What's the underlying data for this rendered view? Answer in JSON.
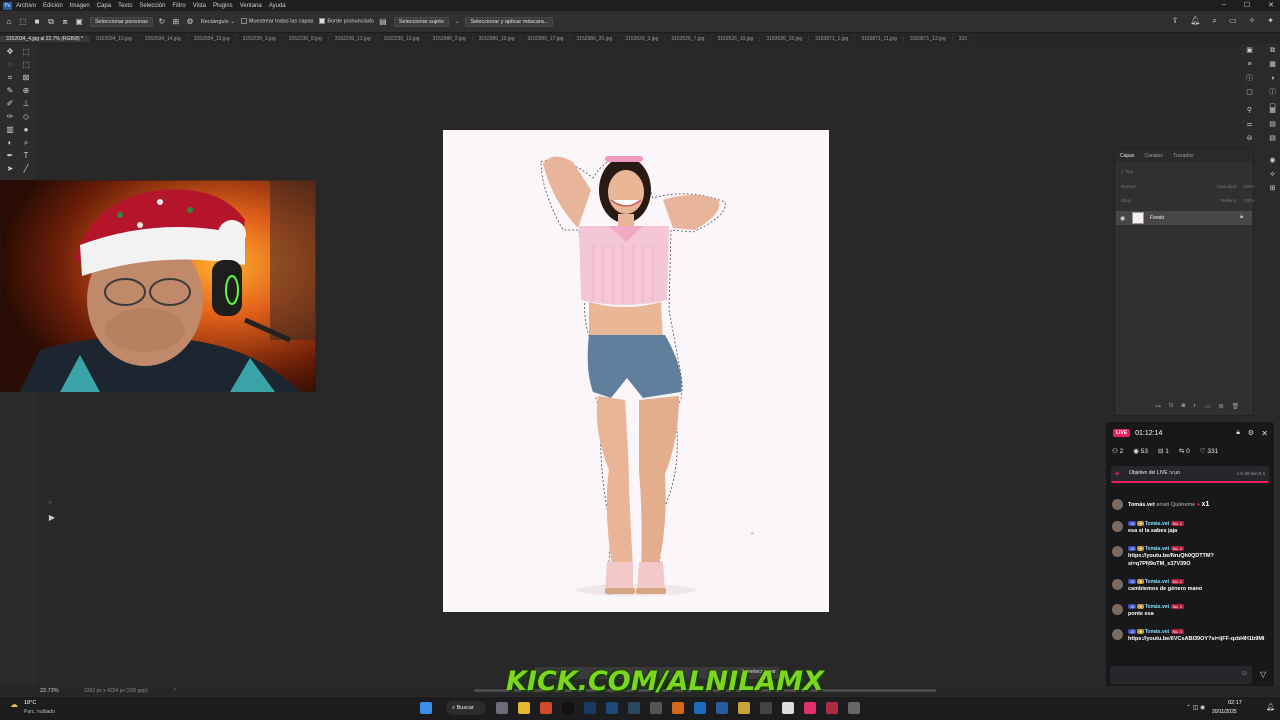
{
  "menu": {
    "logo": "Ps",
    "items": [
      "Archivo",
      "Edición",
      "Imagen",
      "Capa",
      "Texto",
      "Selección",
      "Filtro",
      "Vista",
      "Plugins",
      "Ventana",
      "Ayuda"
    ]
  },
  "options": {
    "select_person": "Seleccionar personas",
    "mode": "Rectángulo",
    "sample_all": "Muestrear todas las capas",
    "hard_edge": "Borde pronunciado",
    "select_subject": "Seleccionar sujeto",
    "select_mask": "Seleccionar y aplicar máscara..."
  },
  "tabs": [
    "3152034_4.jpg al 22.7% (RGB/8) *",
    "3152034_10.jpg",
    "3152034_14.jpg",
    "3152034_15.jpg",
    "3152230_3.jpg",
    "3152230_8.jpg",
    "3152230_12.jpg",
    "3152230_13.jpg",
    "3152980_2.jpg",
    "3152980_10.jpg",
    "3152980_17.jpg",
    "3152980_20.jpg",
    "3153526_3.jpg",
    "3153526_7.jpg",
    "3153526_10.jpg",
    "3153526_15.jpg",
    "3153871_1.jpg",
    "3153871_11.jpg",
    "3153871_13.jpg",
    "315"
  ],
  "layers": {
    "tabs": [
      "Capas",
      "Canales",
      "Trazados"
    ],
    "filter": "Tipo",
    "blend": "Normal",
    "opacity_label": "Opacidad:",
    "opacity": "100%",
    "lock_label": "Bloq.:",
    "fill_label": "Relleno:",
    "fill": "100%",
    "layer_name": "Fondo"
  },
  "chat": {
    "live": "LIVE",
    "timer": "01:12:14",
    "stats": [
      "2",
      "53",
      "1",
      "0",
      "331"
    ],
    "goal": "Objetivo del LIVE :v:uo",
    "goal_time": "1 h 40 min 5 s",
    "gift": {
      "user": "Tomás.vet",
      "text": "envió Quiéreme",
      "count": "x1"
    },
    "messages": [
      {
        "user": "Tomás.vet",
        "level": "15",
        "rank": "No. 1",
        "text": "esa si la sabes jaja"
      },
      {
        "user": "Tomás.vet",
        "level": "15",
        "rank": "No. 1",
        "text": "https://youtu.be/NruQh0QDTTM?si=q7PN9oTM_s37V39O"
      },
      {
        "user": "Tomás.vet",
        "level": "15",
        "rank": "No. 1",
        "text": "cambiemos de género mano"
      },
      {
        "user": "Tomás.vet",
        "level": "15",
        "rank": "No. 1",
        "text": "ponte esa"
      },
      {
        "user": "Tomás.vet",
        "level": "15",
        "rank": "No. 1",
        "text": "https://youtu.be/6VCsABI39OY?si=IjFF-qzbI4H1b9MI"
      }
    ]
  },
  "status": {
    "zoom": "22.73%",
    "size": "3392 px x 4224 px (300 ppp)"
  },
  "floating_bar": {
    "deselect": "Deseleccionar"
  },
  "watermark": "KICK.COM/ALNILAMX",
  "taskbar": {
    "temp": "18°C",
    "weather": "Parc. nublado",
    "search": "Buscar",
    "time": "02:17",
    "date": "20/11/2025"
  }
}
